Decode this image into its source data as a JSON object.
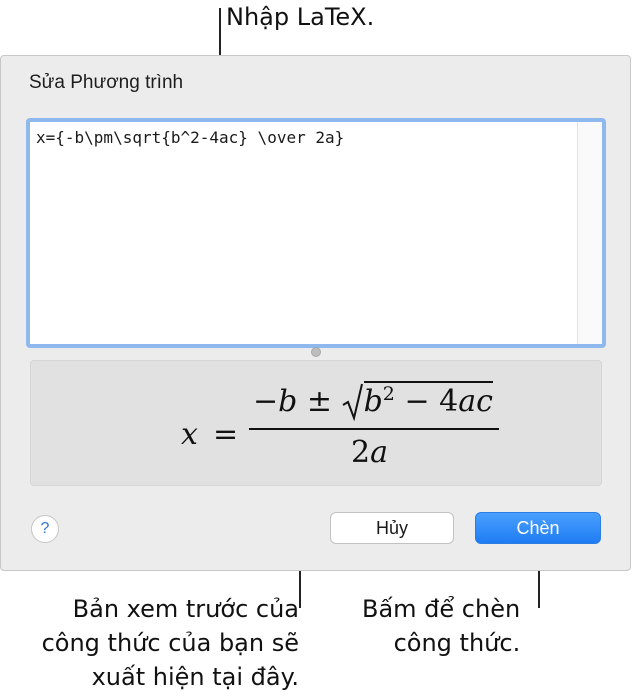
{
  "callouts": {
    "latex_input": "Nhập LaTeX.",
    "preview_line1": "Bản xem trước của",
    "preview_line2": "công thức của bạn sẽ",
    "preview_line3": "xuất hiện tại đây.",
    "insert_line1": "Bấm để chèn",
    "insert_line2": "công thức."
  },
  "dialog": {
    "title": "Sửa Phương trình",
    "latex_value": "x={-b\\pm\\sqrt{b^2-4ac} \\over 2a}",
    "help_label": "?",
    "cancel_label": "Hủy",
    "insert_label": "Chèn",
    "accent_color": "#1f7cf2",
    "focus_ring_color": "#8fb8ee"
  },
  "preview": {
    "lhs": "x",
    "equals": "=",
    "numerator_minus_b": "−b",
    "plus_minus": "±",
    "radicand_b": "b",
    "exponent": "2",
    "minus_four": "− 4",
    "ac": "ac",
    "denominator_two": "2",
    "denominator_a": "a"
  }
}
